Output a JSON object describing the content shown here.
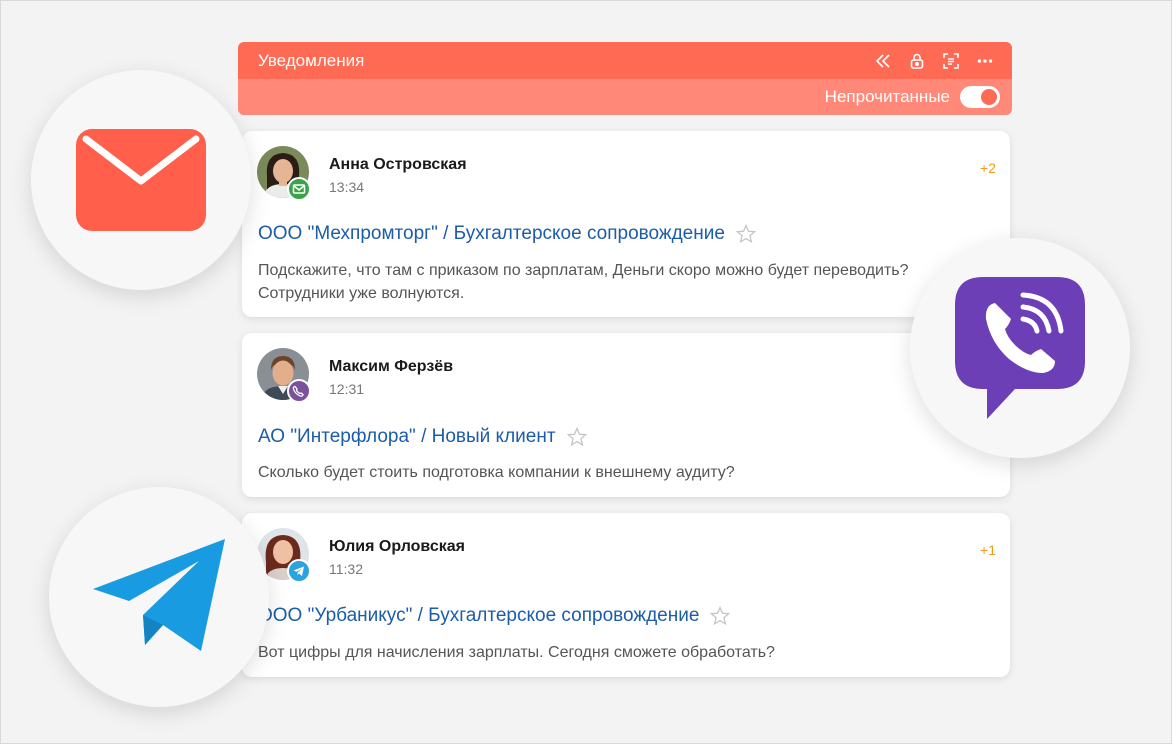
{
  "panel": {
    "title": "Уведомления",
    "header_icons": [
      "collapse-icon",
      "lock-icon",
      "scan-icon",
      "more-icon"
    ],
    "filter_label": "Непрочитанные",
    "filter_enabled": true,
    "accent_color": "#ff6a55"
  },
  "notifications": [
    {
      "name": "Анна Островская",
      "time": "13:34",
      "count": "+2",
      "channel": "email",
      "subject": "ООО \"Мехпромторг\" / Бухгалтерское сопровождение",
      "message": "Подскажите, что там с приказом по зарплатам, Деньги скоро можно будет переводить? Сотрудники уже волнуются."
    },
    {
      "name": "Максим Ферзёв",
      "time": "12:31",
      "count": "",
      "channel": "viber",
      "subject": "АО \"Интерфлора\" / Новый клиент",
      "message": "Сколько будет стоить подготовка компании к внешнему аудиту?"
    },
    {
      "name": "Юлия Орловская",
      "time": "11:32",
      "count": "+1",
      "channel": "telegram",
      "subject": "ООО \"Урбаникус\" / Бухгалтерское сопровождение",
      "message": "Вот цифры для начисления зарплаты. Сегодня сможете обработать?"
    }
  ],
  "channel_logos": [
    "mail-logo-icon",
    "viber-logo-icon",
    "telegram-logo-icon"
  ],
  "colors": {
    "mail": "#ff5f4b",
    "viber": "#6d3fb6",
    "telegram": "#199be2",
    "link": "#1c5ca8",
    "count": "#f39a1e"
  }
}
